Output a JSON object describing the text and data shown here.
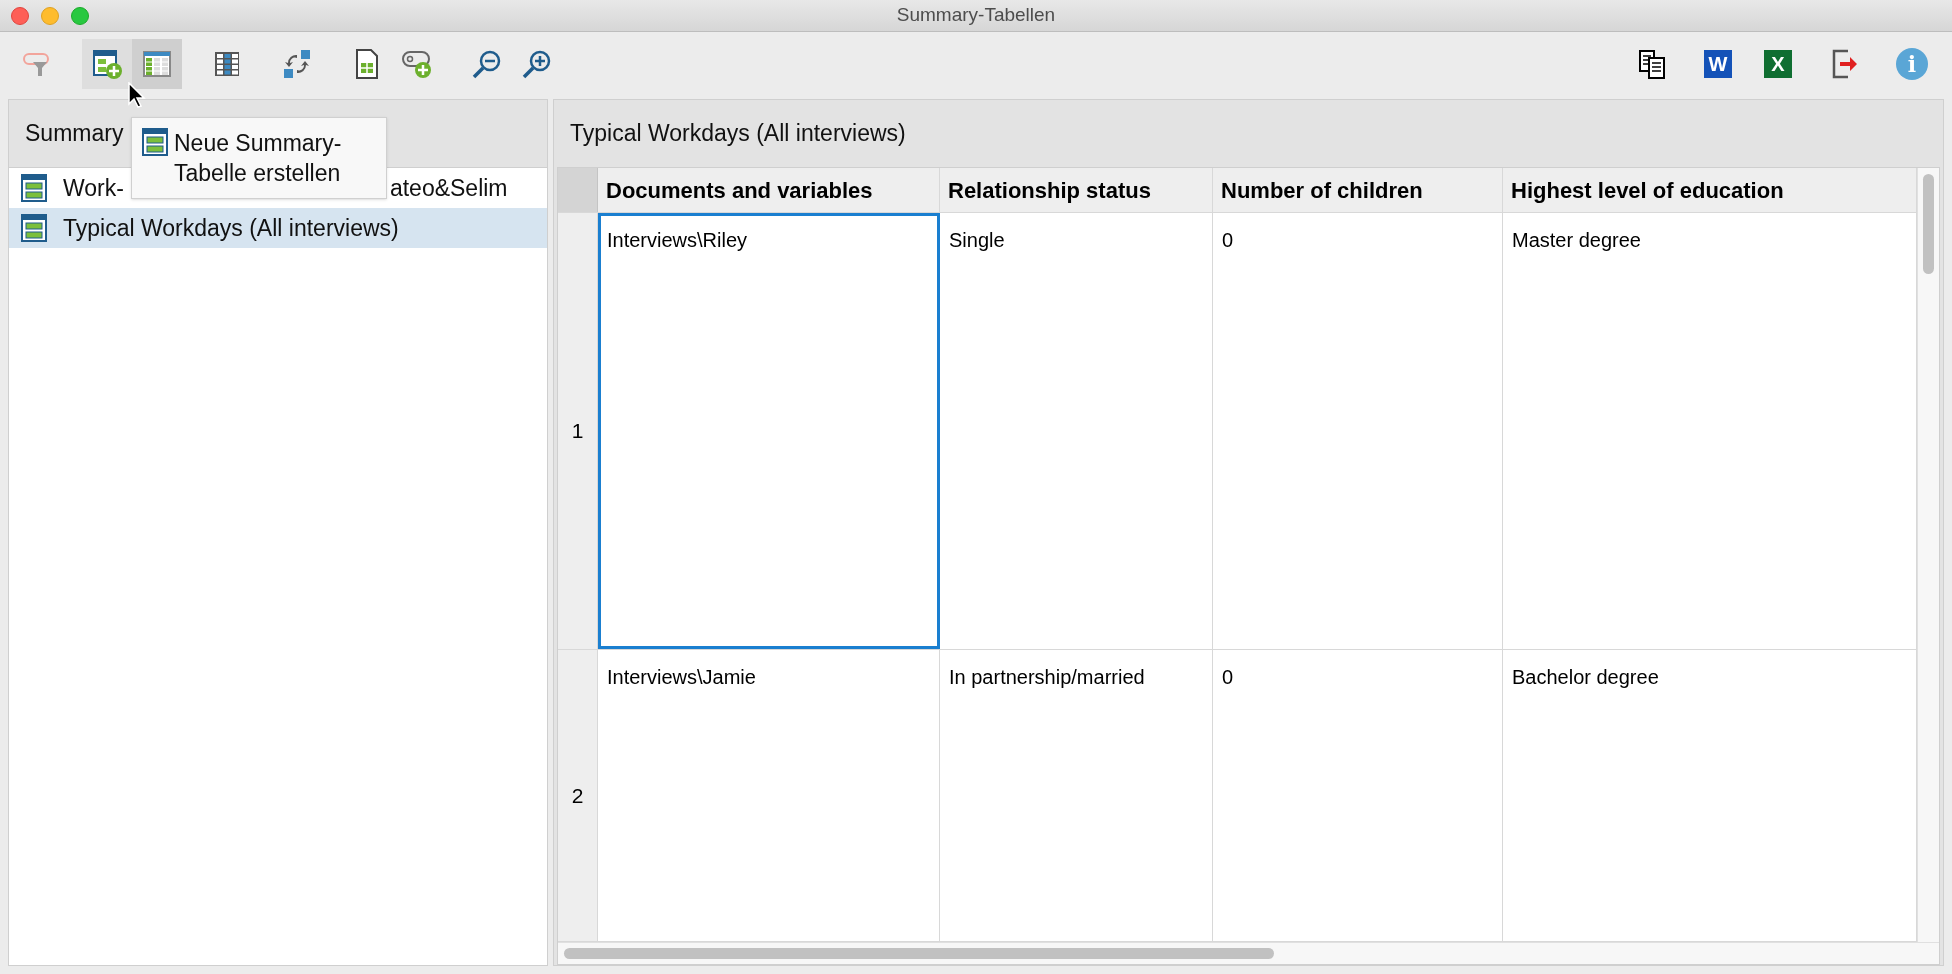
{
  "window": {
    "title": "Summary-Tabellen"
  },
  "toolbar": [
    {
      "kind": "filter",
      "selected": false,
      "hovered": false
    },
    {
      "kind": "new-table",
      "selected": false,
      "hovered": true
    },
    {
      "kind": "grid",
      "selected": true,
      "hovered": false
    },
    {
      "kind": "columns",
      "selected": false,
      "hovered": false
    },
    {
      "kind": "swap",
      "selected": false,
      "hovered": false
    },
    {
      "kind": "sheet",
      "selected": false,
      "hovered": false
    },
    {
      "kind": "tag-add",
      "selected": false,
      "hovered": false
    },
    {
      "kind": "zoom-out",
      "selected": false,
      "hovered": false
    },
    {
      "kind": "zoom-in",
      "selected": false,
      "hovered": false
    }
  ],
  "toolbar_right": [
    {
      "kind": "copy"
    },
    {
      "kind": "word",
      "label": "W"
    },
    {
      "kind": "excel",
      "label": "X"
    },
    {
      "kind": "exit"
    },
    {
      "kind": "info",
      "label": "i"
    }
  ],
  "tooltip": {
    "lines": [
      "Neue Summary-",
      "Tabelle erstellen"
    ]
  },
  "sidebar": {
    "title": "Summary",
    "items": [
      {
        "parts": [
          "Work-",
          "ateo&Selim"
        ],
        "selected": false
      },
      {
        "parts": [
          "Typical Workdays (All interviews)"
        ],
        "selected": true
      }
    ]
  },
  "table": {
    "title": "Typical Workdays (All interviews)",
    "columns": [
      "Documents and variables",
      "Relationship status",
      "Number of children",
      "Highest level of education"
    ],
    "rows": [
      {
        "number": "1",
        "cells": [
          {
            "text": "Interviews\\Riley",
            "selected": true
          },
          {
            "text": "Single",
            "selected": false
          },
          {
            "text": "0",
            "selected": false
          },
          {
            "text": "Master degree",
            "selected": false
          }
        ]
      },
      {
        "number": "2",
        "cells": [
          {
            "text": "Interviews\\Jamie",
            "selected": false
          },
          {
            "text": "In partnership/married",
            "selected": false
          },
          {
            "text": "0",
            "selected": false
          },
          {
            "text": "Bachelor degree",
            "selected": false
          }
        ]
      }
    ]
  }
}
